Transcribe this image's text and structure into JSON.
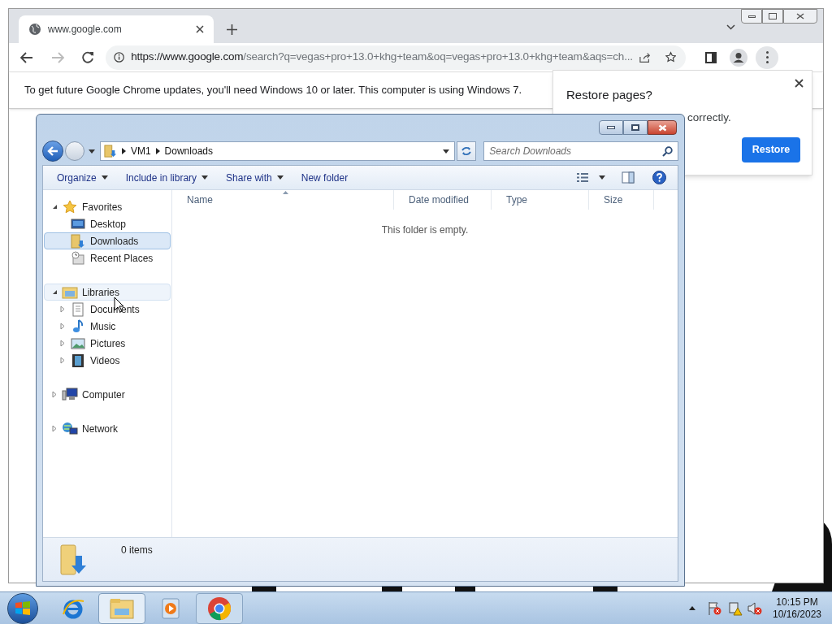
{
  "browser": {
    "tab": {
      "title": "www.google.com"
    },
    "address": {
      "url_host": "https://www.google.com",
      "url_rest": "/search?q=vegas+pro+13.0+khg+team&oq=vegas+pro+13.0+khg+team&aqs=ch..."
    },
    "infobar": "To get future Google Chrome updates, you'll need Windows 10 or later. This computer is using Windows 7.",
    "restore_popup": {
      "title": "Restore pages?",
      "message_visible": "correctly.",
      "button": "Restore"
    }
  },
  "explorer": {
    "breadcrumb": [
      "VM1",
      "Downloads"
    ],
    "search": {
      "placeholder": "Search Downloads"
    },
    "commands": [
      {
        "label": "Organize",
        "dropdown": true
      },
      {
        "label": "Include in library",
        "dropdown": true
      },
      {
        "label": "Share with",
        "dropdown": true
      },
      {
        "label": "New folder",
        "dropdown": false
      }
    ],
    "nav": [
      {
        "label": "Favorites",
        "expanded": true,
        "selected": false,
        "hovered": false,
        "children": [
          {
            "label": "Desktop",
            "selected": false,
            "hovered": false
          },
          {
            "label": "Downloads",
            "selected": true,
            "hovered": false
          },
          {
            "label": "Recent Places",
            "selected": false,
            "hovered": false
          }
        ]
      },
      {
        "label": "Libraries",
        "expanded": true,
        "selected": false,
        "hovered": true,
        "children": [
          {
            "label": "Documents",
            "expanded": false,
            "selected": false,
            "hovered": false
          },
          {
            "label": "Music",
            "expanded": false,
            "selected": false,
            "hovered": false
          },
          {
            "label": "Pictures",
            "expanded": false,
            "selected": false,
            "hovered": false
          },
          {
            "label": "Videos",
            "expanded": false,
            "selected": false,
            "hovered": false
          }
        ]
      },
      {
        "label": "Computer",
        "expanded": false,
        "selected": false,
        "hovered": false
      },
      {
        "label": "Network",
        "expanded": false,
        "selected": false,
        "hovered": false
      }
    ],
    "columns": [
      {
        "label": "Name",
        "sorted": true
      },
      {
        "label": "Date modified",
        "sorted": false
      },
      {
        "label": "Type",
        "sorted": false
      },
      {
        "label": "Size",
        "sorted": false
      }
    ],
    "empty_message": "This folder is empty.",
    "status": "0 items"
  },
  "taskbar": {
    "apps": [
      {
        "running": false,
        "active": false
      },
      {
        "running": true,
        "active": true
      },
      {
        "running": false,
        "active": false
      },
      {
        "running": true,
        "active": false
      }
    ],
    "clock": {
      "time": "10:15 PM",
      "date": "10/16/2023"
    }
  }
}
